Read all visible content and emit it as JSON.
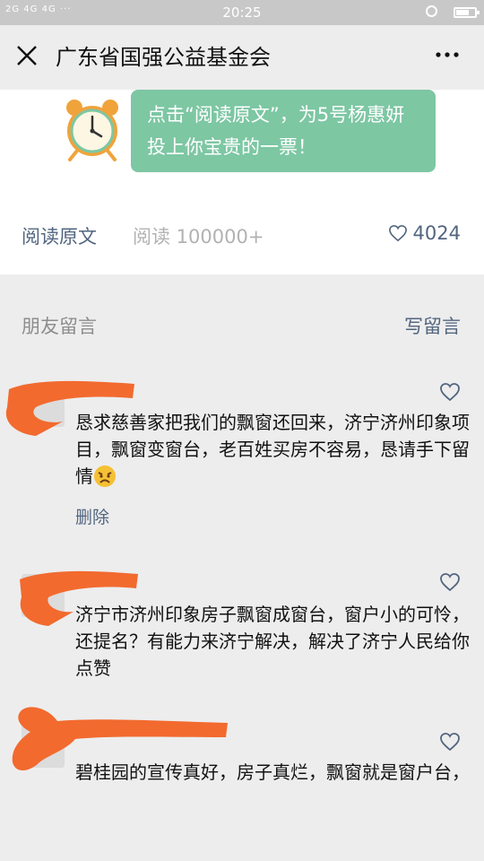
{
  "status_bar": {
    "left_text": "2G 4G 4G ···",
    "time": "20:25"
  },
  "navbar": {
    "title": "广东省国强公益基金会",
    "close_icon": "close-icon",
    "more_icon": "more-icon"
  },
  "article": {
    "banner_text": "点击“阅读原文”，为5号杨惠妍投上你宝贵的一票！",
    "read_original": "阅读原文",
    "read_count": "阅读 100000+",
    "like_count": "4024",
    "icons": [
      "alarm-clock-icon",
      "heart-icon"
    ]
  },
  "comments": {
    "section_title": "朋友留言",
    "write_label": "写留言",
    "items": [
      {
        "text": "恳求慈善家把我们的飘窗还回来，济宁济州印象项目，飘窗变窗台，老百姓买房不容易，恳请手下留情",
        "emoji": "angry-face-icon",
        "delete_label": "删除"
      },
      {
        "text": "济宁市济州印象房子飘窗成窗台，窗户小的可怜，还提名？有能力来济宁解决，解决了济宁人民给你点赞"
      },
      {
        "text": "碧桂园的宣传真好，房子真烂，飘窗就是窗户台，"
      }
    ]
  },
  "colors": {
    "banner_bg": "#7dc7a3",
    "link_blue": "#52657f",
    "redaction_orange": "#f26a2e"
  }
}
